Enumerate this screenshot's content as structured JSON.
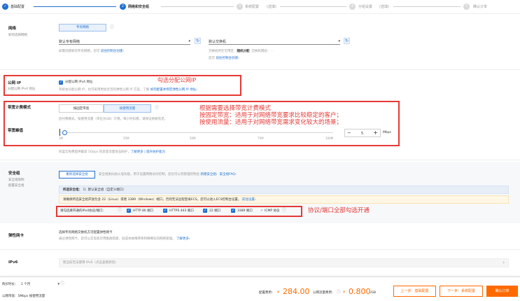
{
  "steps": [
    {
      "label": "基础配置",
      "tag": ""
    },
    {
      "num": "2",
      "label": "网络和安全组",
      "tag": ""
    },
    {
      "num": "3",
      "label": "系统配置",
      "tag": "(选填)"
    },
    {
      "num": "4",
      "label": "分组设置",
      "tag": "(选填)"
    },
    {
      "num": "5",
      "label": "确认订单",
      "tag": ""
    }
  ],
  "network": {
    "title": "网络",
    "subtitle": "如何选择网络",
    "type_btn": "专有网络",
    "vpc_value": "默认专有网络",
    "vpc_help_prefix": "如需创建新的专有网络，您可",
    "vpc_help_link": "前往控制台创建›",
    "vswitch_value": "默认交换机",
    "vswitch_zone_label": "交换机所在可用区：",
    "vswitch_zone_value": "随机分配",
    "vswitch_ip_label": "交换机网段：",
    "vswitch_ip_value": "-",
    "vswitch_help_prefix": "您可",
    "vswitch_help_link": "前往控制台创建›"
  },
  "public_ip": {
    "title": "公网 IP",
    "subtitle": "分配公网 IPv4 地址",
    "checkbox_label": "分配公网 IPv4 地址",
    "desc_prefix": "系统会分配公网 IP，也可采用更加灵活的弹性公网 IP 方案，了解",
    "desc_link": "如何配置并绑定弹性公网 IP 地址›",
    "annotation": "勾选分配公网IP"
  },
  "billing": {
    "title": "带宽计费模式",
    "btn_fixed": "按固定带宽",
    "btn_traffic": "按使用流量",
    "desc": "后付费模式，按使用流量（单位为GB）计费，每小时扣费。请保证余额充足。",
    "peak_title": "带宽峰值",
    "ticks": [
      "1M",
      "25M",
      "50M",
      "75M",
      "100M"
    ],
    "bandwidth": "5",
    "unit": "Mbps",
    "minus": "−",
    "plus": "+",
    "footnote_prefix": "阿里云免费提供最高 5Gbps 的恶意流量攻击防护，",
    "footnote_link": "了解更多 | 提升防护能力",
    "annotations": [
      "根据需要选择带宽计费模式",
      "按固定带宽：适用于对网络带宽要求比较稳定的客户；",
      "按使用流量：适用于对网络带宽需求变化较大的场景；"
    ]
  },
  "security": {
    "title": "安全组",
    "sub1": "安全组限制",
    "sub2": "配置安全组",
    "reselect_btn": "重新选择安全组",
    "hint": "安全组类似防火墙功能，用于设置网络访问控制，您也可以到管理控制台",
    "hint_link1": "新建安全组›",
    "hint_link2": "安全组FAQ›",
    "selected_label": "所选安全组：",
    "selected_value": "1）默认安全组（自定义端口）",
    "warning_prefix": "请确保所选安全组开放包含 22（Linux）或者 3389（Windows）端口，否则无法远程登录ECS。您可以进入ECS控制台设置。",
    "warning_link": "前往设置›",
    "ports_label": "请勾选要开通的IPv4协议/端口：",
    "ports": [
      "HTTP 80 端口",
      "HTTPS 443 端口",
      "22 端口",
      "3389 端口"
    ],
    "icmp": "ICMP 协议",
    "annotation": "协议/端口全部勾选开通"
  },
  "eni": {
    "title": "弹性网卡",
    "line1": "选择专有网络交换机方可配置弹性网卡",
    "line2_prefix": "通过弹性网卡，您可以实现高可用集群搭建、低成本故障转移和精细化的网络管理。",
    "line2_link": "了解更多›"
  },
  "ipv6": {
    "title": "IPv6",
    "value": "暂当前无法使用 IPv6（点击查看原因）"
  },
  "footer": {
    "duration_label": "购买时长：",
    "duration_value": "1 个月",
    "bandwidth_label": "公网带宽：",
    "bandwidth_value": "5Mbps 按使用流量",
    "config_fee_label": "配置费用：",
    "config_fee_currency": "¥",
    "config_fee": "284.00",
    "traffic_fee_label": "公网流量费用：",
    "traffic_fee_currency": "¥",
    "traffic_fee": "0.800",
    "traffic_unit": "/GB",
    "prev_btn": "上一步：基础配置",
    "next_btn": "下一步：系统配置",
    "confirm_btn": "确认订单"
  },
  "colors": {
    "accent": "#1f6fd1",
    "annotation": "#e53935",
    "price": "#ff6a00"
  }
}
